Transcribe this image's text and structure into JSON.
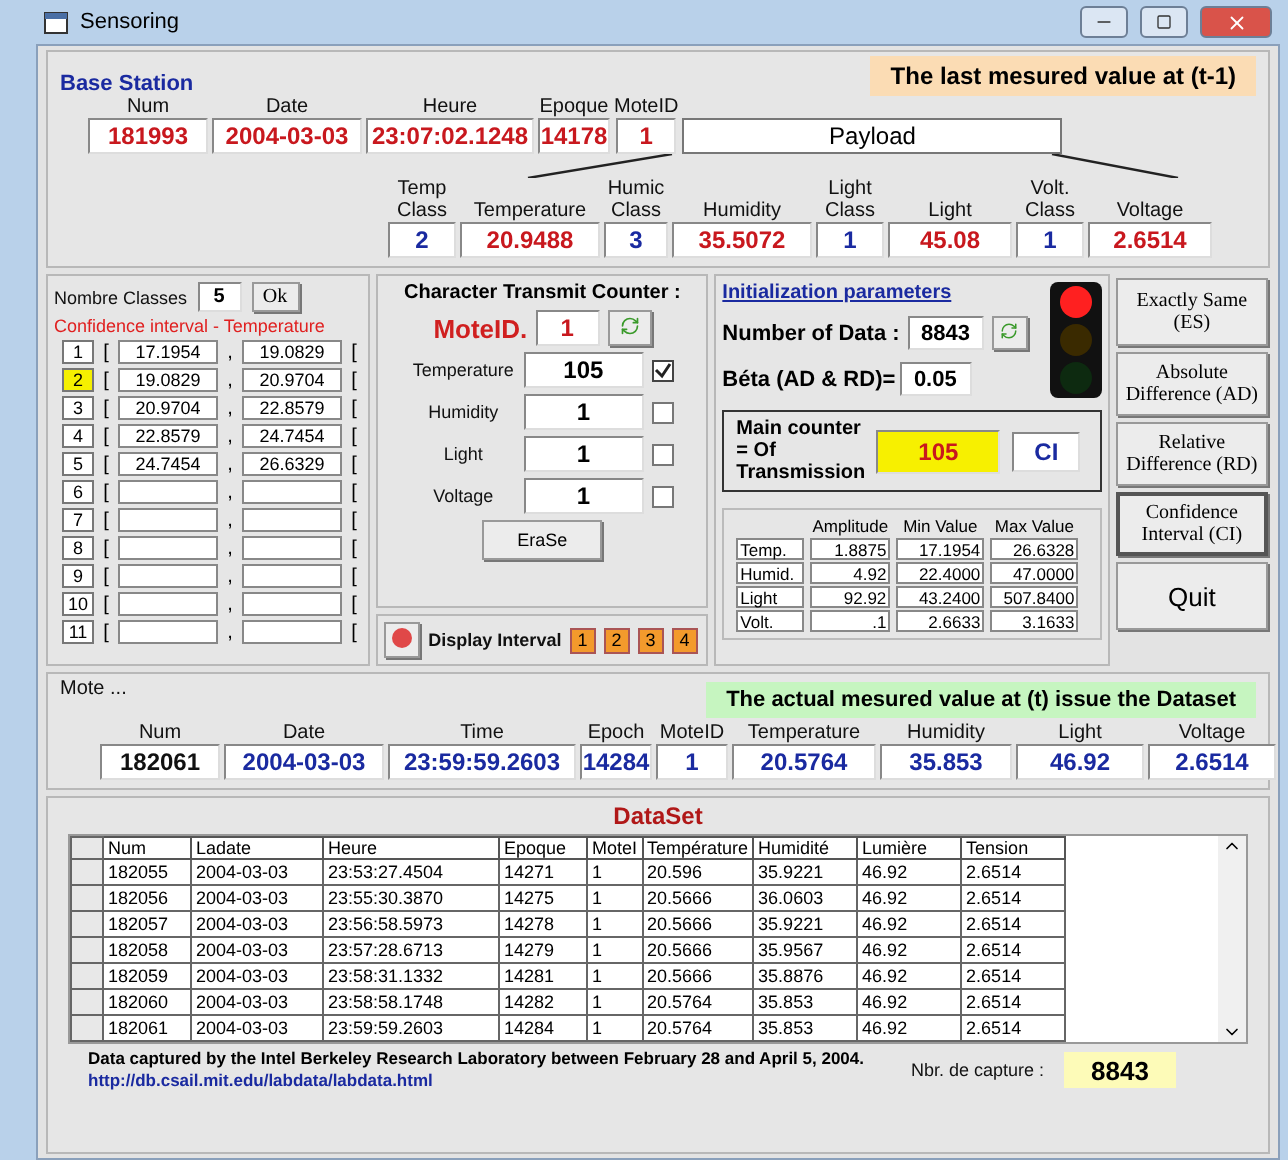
{
  "window": {
    "title": "Sensoring"
  },
  "base_station": {
    "title": "Base Station",
    "banner": "The last mesured value at (t-1)",
    "payload": "Payload",
    "fields": [
      {
        "label": "Num",
        "value": "181993"
      },
      {
        "label": "Date",
        "value": "2004-03-03"
      },
      {
        "label": "Heure",
        "value": "23:07:02.1248"
      },
      {
        "label": "Epoque",
        "value": "14178"
      },
      {
        "label": "MoteID",
        "value": "1"
      }
    ],
    "sensors": [
      {
        "kind": "class",
        "label": "Temp Class",
        "value": "2"
      },
      {
        "kind": "value",
        "label": "Temperature",
        "value": "20.9488"
      },
      {
        "kind": "class",
        "label": "Humic Class",
        "value": "3"
      },
      {
        "kind": "value",
        "label": "Humidity",
        "value": "35.5072"
      },
      {
        "kind": "class",
        "label": "Light Class",
        "value": "1"
      },
      {
        "kind": "value",
        "label": "Light",
        "value": "45.08"
      },
      {
        "kind": "class",
        "label": "Volt. Class",
        "value": "1"
      },
      {
        "kind": "value",
        "label": "Voltage",
        "value": "2.6514"
      }
    ]
  },
  "classes": {
    "count_label": "Nombre Classes",
    "count": "5",
    "ok": "Ok",
    "interval_title": "Confidence interval - Temperature",
    "rows": [
      {
        "index": "1",
        "selected": false,
        "open": "[",
        "low": "17.1954",
        "sep": ",",
        "high": "19.0829",
        "close": "["
      },
      {
        "index": "2",
        "selected": true,
        "open": "[",
        "low": "19.0829",
        "sep": ",",
        "high": "20.9704",
        "close": "["
      },
      {
        "index": "3",
        "selected": false,
        "open": "[",
        "low": "20.9704",
        "sep": ",",
        "high": "22.8579",
        "close": "["
      },
      {
        "index": "4",
        "selected": false,
        "open": "[",
        "low": "22.8579",
        "sep": ",",
        "high": "24.7454",
        "close": "["
      },
      {
        "index": "5",
        "selected": false,
        "open": "[",
        "low": "24.7454",
        "sep": ",",
        "high": "26.6329",
        "close": "["
      },
      {
        "index": "6",
        "selected": false,
        "open": "[",
        "sep": ",",
        "close": "["
      },
      {
        "index": "7",
        "selected": false,
        "open": "[",
        "sep": ",",
        "close": "["
      },
      {
        "index": "8",
        "selected": false,
        "open": "[",
        "sep": ",",
        "close": "["
      },
      {
        "index": "9",
        "selected": false,
        "open": "[",
        "sep": ",",
        "close": "["
      },
      {
        "index": "10",
        "selected": false,
        "open": "[",
        "sep": ",",
        "close": "["
      },
      {
        "index": "11",
        "selected": false,
        "open": "[",
        "sep": ",",
        "close": "["
      }
    ]
  },
  "counter": {
    "title": "Character Transmit Counter :",
    "mote_label": "MoteID.",
    "mote_id": "1",
    "erase": "EraSe",
    "rows": [
      {
        "label": "Temperature",
        "value": "105",
        "checked": true
      },
      {
        "label": "Humidity",
        "value": "1",
        "checked": false
      },
      {
        "label": "Light",
        "value": "1",
        "checked": false
      },
      {
        "label": "Voltage",
        "value": "1",
        "checked": false
      }
    ]
  },
  "display_interval": {
    "label": "Display Interval",
    "buttons": [
      "1",
      "2",
      "3",
      "4"
    ]
  },
  "init": {
    "title": "Initialization parameters",
    "number_label": "Number of Data :",
    "number": "8843",
    "beta_label": "Béta  (AD & RD)=",
    "beta": "0.05",
    "main_counter_label": "Main counter = Of Transmission",
    "main_counter": "105",
    "mode": "CI",
    "traffic_lights": [
      {
        "lit": true
      },
      {
        "lit": false
      },
      {
        "lit": false
      }
    ]
  },
  "stats": {
    "columns": [
      "Amplitude",
      "Min Value",
      "Max Value"
    ],
    "rows": [
      {
        "label": "Temp.",
        "values": [
          "1.8875",
          "17.1954",
          "26.6328"
        ]
      },
      {
        "label": "Humid.",
        "values": [
          "4.92",
          "22.4000",
          "47.0000"
        ]
      },
      {
        "label": "Light",
        "values": [
          "92.92",
          "43.2400",
          "507.8400"
        ]
      },
      {
        "label": "Volt.",
        "values": [
          ".1",
          "2.6633",
          "3.1633"
        ]
      }
    ]
  },
  "methods": [
    {
      "label": "Exactly Same (ES)",
      "selected": false
    },
    {
      "label": "Absolute Difference (AD)",
      "selected": false
    },
    {
      "label": "Relative Difference (RD)",
      "selected": false
    },
    {
      "label": "Confidence Interval (CI)",
      "selected": true
    }
  ],
  "quit": "Quit",
  "mote": {
    "title": "Mote ...",
    "banner": "The actual mesured value at (t) issue the Dataset",
    "fields": [
      {
        "label": "Num",
        "value": "182061"
      },
      {
        "label": "Date",
        "value": "2004-03-03"
      },
      {
        "label": "Time",
        "value": "23:59:59.2603"
      },
      {
        "label": "Epoch",
        "value": "14284"
      },
      {
        "label": "MoteID",
        "value": "1"
      },
      {
        "label": "Temperature",
        "value": "20.5764"
      },
      {
        "label": "Humidity",
        "value": "35.853"
      },
      {
        "label": "Light",
        "value": "46.92"
      },
      {
        "label": "Voltage",
        "value": "2.6514"
      }
    ]
  },
  "dataset": {
    "title": "DataSet",
    "columns": [
      "Num",
      "Ladate",
      "Heure",
      "Epoque",
      "MoteI",
      "Température",
      "Humidité",
      "Lumière",
      "Tension"
    ],
    "rows": [
      [
        "182055",
        "2004-03-03",
        "23:53:27.4504",
        "14271",
        "1",
        "20.596",
        "35.9221",
        "46.92",
        "2.6514"
      ],
      [
        "182056",
        "2004-03-03",
        "23:55:30.3870",
        "14275",
        "1",
        "20.5666",
        "36.0603",
        "46.92",
        "2.6514"
      ],
      [
        "182057",
        "2004-03-03",
        "23:56:58.5973",
        "14278",
        "1",
        "20.5666",
        "35.9221",
        "46.92",
        "2.6514"
      ],
      [
        "182058",
        "2004-03-03",
        "23:57:28.6713",
        "14279",
        "1",
        "20.5666",
        "35.9567",
        "46.92",
        "2.6514"
      ],
      [
        "182059",
        "2004-03-03",
        "23:58:31.1332",
        "14281",
        "1",
        "20.5666",
        "35.8876",
        "46.92",
        "2.6514"
      ],
      [
        "182060",
        "2004-03-03",
        "23:58:58.1748",
        "14282",
        "1",
        "20.5764",
        "35.853",
        "46.92",
        "2.6514"
      ],
      [
        "182061",
        "2004-03-03",
        "23:59:59.2603",
        "14284",
        "1",
        "20.5764",
        "35.853",
        "46.92",
        "2.6514"
      ]
    ],
    "credit": "Data captured by the Intel Berkeley Research Laboratory between February 28 and April 5, 2004.",
    "link": "http://db.csail.mit.edu/labdata/labdata.html",
    "capture_label": "Nbr. de capture :",
    "capture": "8843"
  }
}
